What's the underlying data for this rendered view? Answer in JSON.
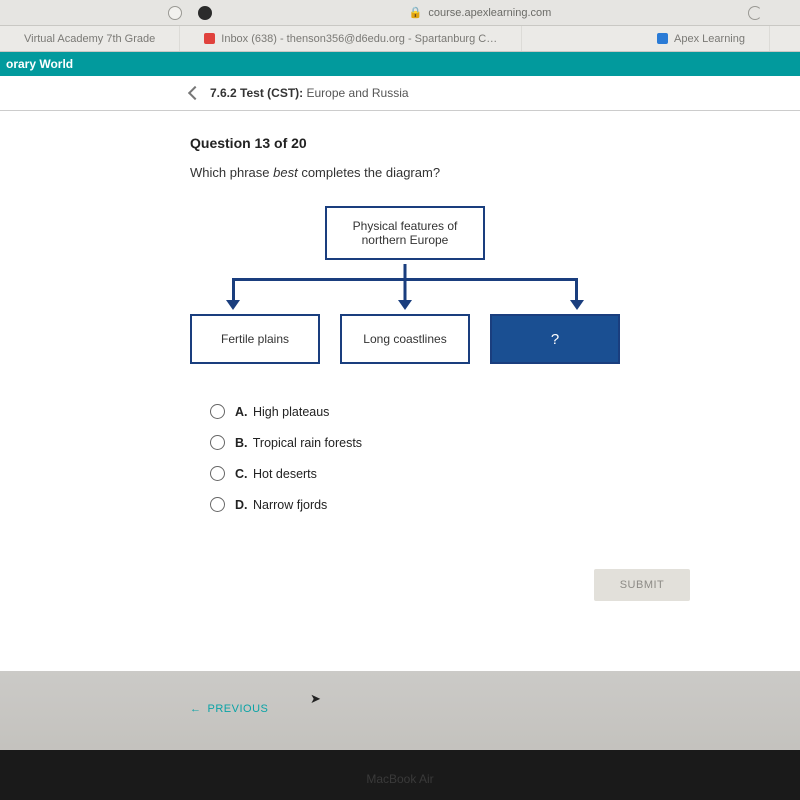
{
  "browser": {
    "url": "course.apexlearning.com",
    "tabs": [
      {
        "label": "Virtual Academy 7th Grade"
      },
      {
        "label": "Inbox (638) - thenson356@d6edu.org - Spartanburg C…"
      },
      {
        "label": "Apex Learning"
      }
    ]
  },
  "header": {
    "course": "orary World",
    "section_number": "7.6.2",
    "section_type": "Test (CST):",
    "section_title": " Europe and Russia"
  },
  "question": {
    "header": "Question 13 of 20",
    "prompt_pre": "Which phrase",
    "prompt_em": "best",
    "prompt_post": "completes the diagram?",
    "options": [
      {
        "letter": "A.",
        "text": "High plateaus"
      },
      {
        "letter": "B.",
        "text": "Tropical rain forests"
      },
      {
        "letter": "C.",
        "text": "Hot deserts"
      },
      {
        "letter": "D.",
        "text": "Narrow fjords"
      }
    ]
  },
  "diagram": {
    "root": "Physical features of northern Europe",
    "children": [
      "Fertile plains",
      "Long coastlines",
      "?"
    ]
  },
  "buttons": {
    "submit": "SUBMIT",
    "previous": "PREVIOUS"
  },
  "hardware": {
    "label": "MacBook Air"
  },
  "colors": {
    "teal": "#029a9d",
    "diagram_border": "#1a3e7e",
    "diagram_fill": "#1a4f92"
  }
}
